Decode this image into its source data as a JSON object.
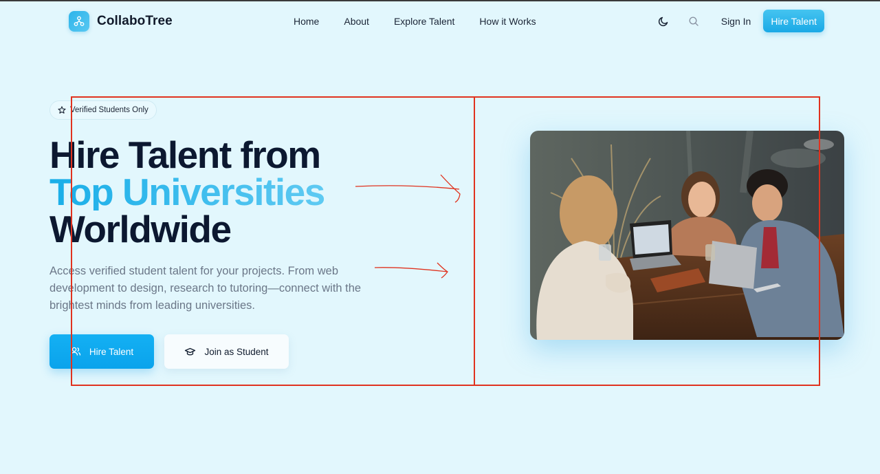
{
  "brand": {
    "name": "CollaboTree"
  },
  "nav": {
    "links": [
      "Home",
      "About",
      "Explore Talent",
      "How it Works"
    ],
    "sign_in": "Sign In",
    "cta": "Hire Talent",
    "icons": [
      "moon-icon",
      "search-icon"
    ]
  },
  "hero": {
    "badge": "Verified Students Only",
    "title_line1": "Hire Talent from",
    "title_accent": "Top Universities",
    "title_line3": "Worldwide",
    "subtitle": "Access verified student talent for your projects. From web development to design, research to tutoring—connect with the brightest minds from leading universities.",
    "primary_cta": "Hire Talent",
    "secondary_cta": "Join as Student",
    "photo_alt": "students working together at a table"
  },
  "colors": {
    "background": "#e2f7fd",
    "accent": "#14b0f3",
    "title": "#0c1830",
    "annotation": "#e0321e"
  }
}
